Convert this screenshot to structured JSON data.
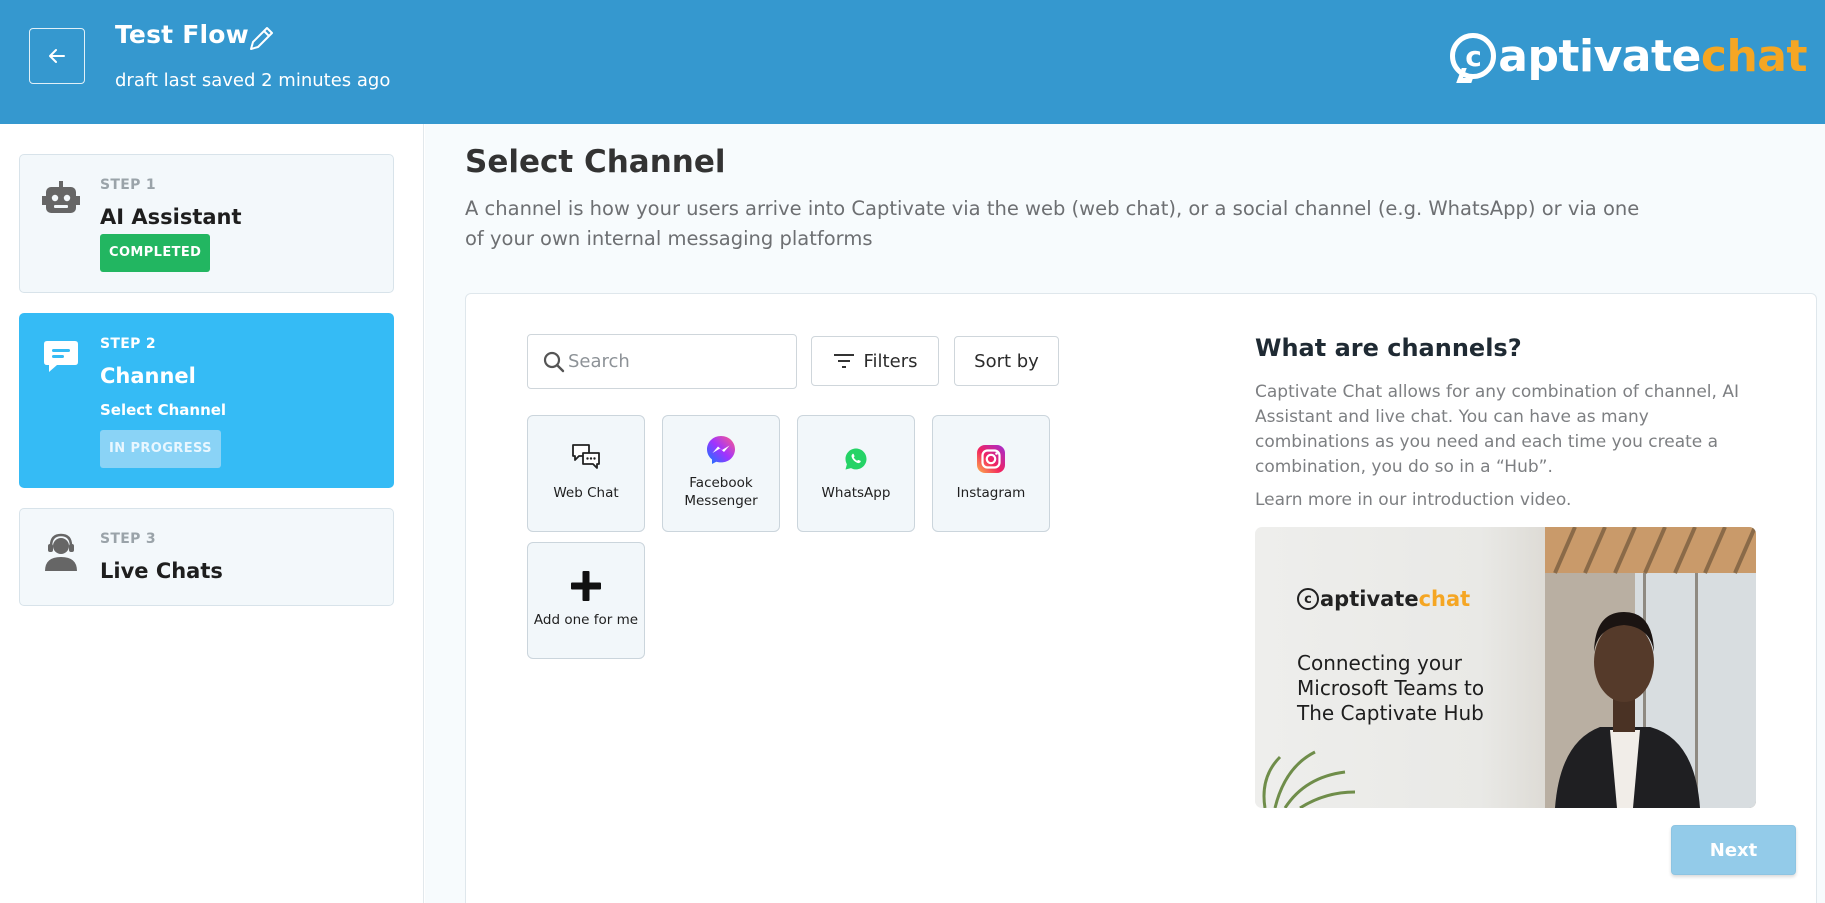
{
  "header": {
    "title": "Test Flow",
    "save_status": "draft last saved 2 minutes ago",
    "logo_part1": "aptivate",
    "logo_part2": "chat",
    "logo_c": "c"
  },
  "steps": [
    {
      "label": "STEP 1",
      "name": "AI Assistant",
      "badge": "COMPLETED",
      "icon": "robot-icon",
      "state": "completed"
    },
    {
      "label": "STEP 2",
      "name": "Channel",
      "sub": "Select Channel",
      "badge": "IN PROGRESS",
      "icon": "chat-bubble-icon",
      "state": "active"
    },
    {
      "label": "STEP 3",
      "name": "Live Chats",
      "icon": "agent-headset-icon",
      "state": "pending"
    }
  ],
  "main": {
    "title": "Select Channel",
    "description": "A channel is how your users arrive into Captivate via the web (web chat), or a social channel (e.g. WhatsApp) or via one of your own internal messaging platforms",
    "search_placeholder": "Search",
    "filters_label": "Filters",
    "sort_label": "Sort by",
    "channels": [
      {
        "label": "Web Chat",
        "icon": "web-chat-icon"
      },
      {
        "label": "Facebook Messenger",
        "icon": "messenger-icon"
      },
      {
        "label": "WhatsApp",
        "icon": "whatsapp-icon"
      },
      {
        "label": "Instagram",
        "icon": "instagram-icon"
      },
      {
        "label": "Add one for me",
        "icon": "plus-icon"
      }
    ],
    "info": {
      "title": "What are channels?",
      "text": "Captivate Chat allows for any combination of channel, AI Assistant and live chat. You can have as many combinations as you need and each time you create a combination, you do so in a “Hub”.",
      "learn_more": "Learn more in our introduction video.",
      "video_logo_part1": "aptivate",
      "video_logo_part2": "chat",
      "video_caption": "Connecting your Microsoft Teams to The Captivate Hub"
    },
    "next_label": "Next"
  },
  "colors": {
    "header": "#3598cf",
    "active_step": "#35bbf5",
    "completed": "#22b661",
    "brand_orange": "#f5a623"
  }
}
